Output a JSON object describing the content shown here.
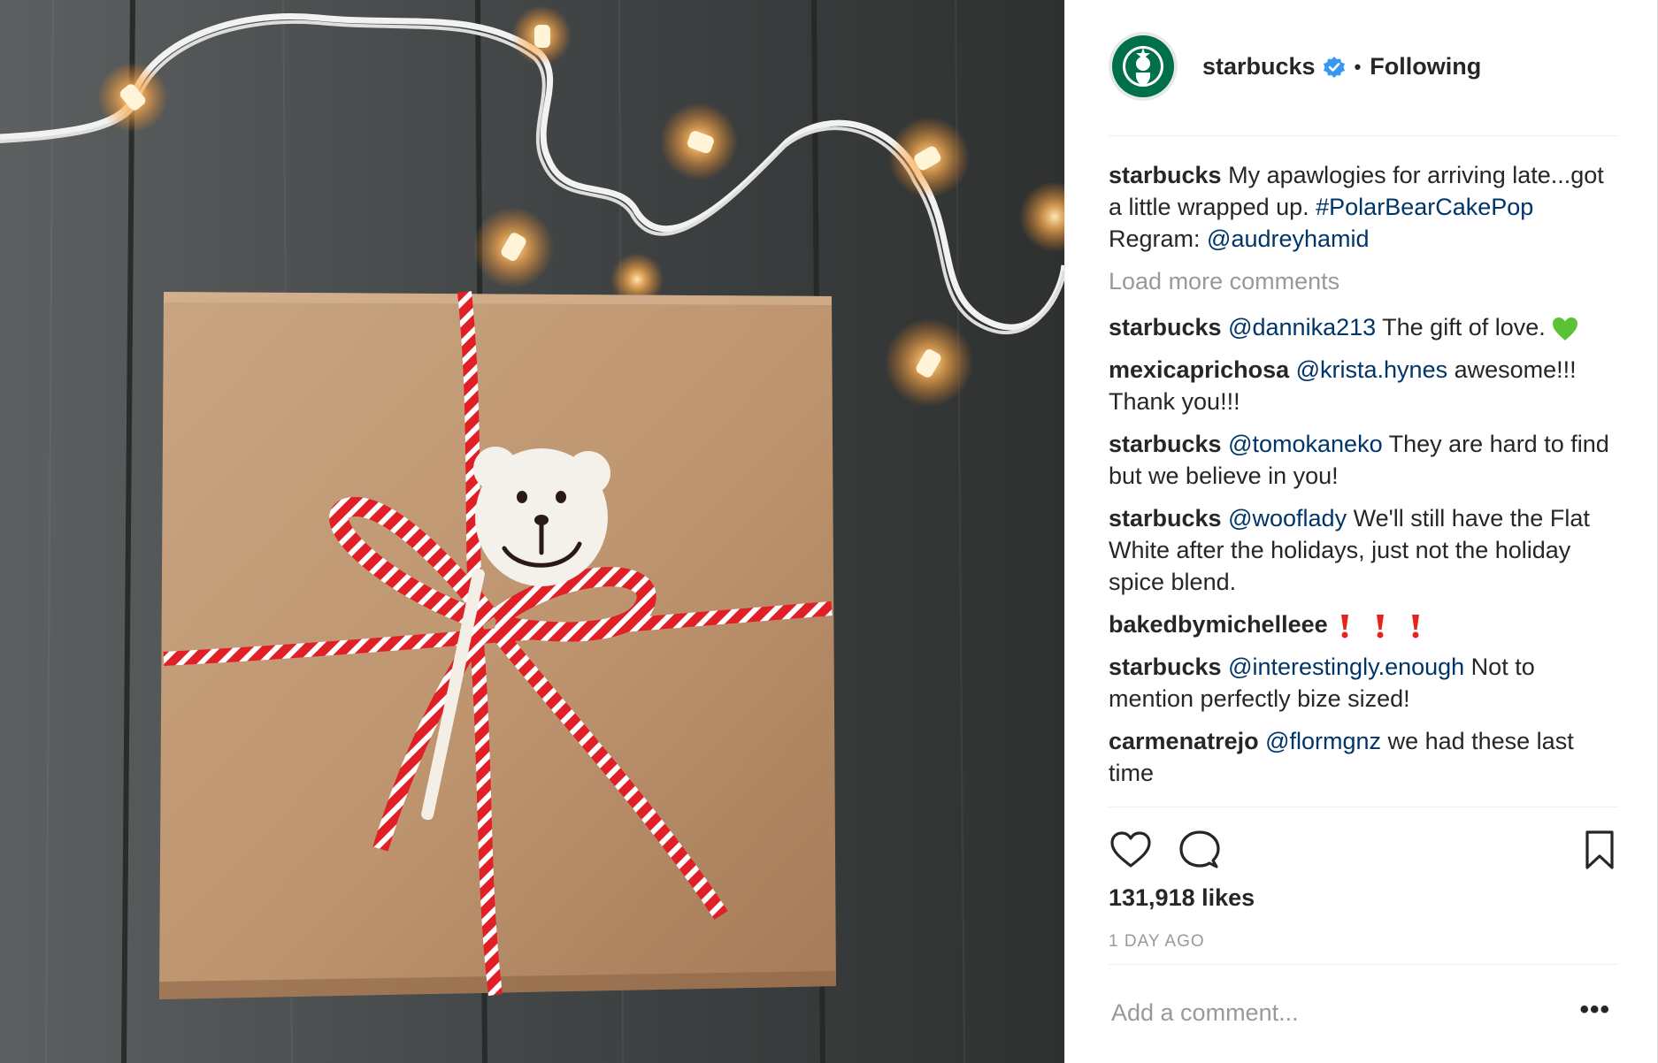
{
  "post": {
    "username": "starbucks",
    "follow_label": "Following",
    "dot": "•",
    "caption": {
      "user": "starbucks",
      "text": " My apawlogies for arriving late...got a little wrapped up. ",
      "hashtag": "#PolarBearCakePop",
      "regram_label": " Regram: ",
      "regram_user": "@audreyhamid"
    },
    "load_more": "Load more comments",
    "comments": [
      {
        "user": "starbucks",
        "mention": "@dannika213",
        "text": " The gift of love. ",
        "emoji": "green-heart"
      },
      {
        "user": "mexicaprichosa",
        "mention": "@krista.hynes",
        "text": " awesome!!! Thank you!!!"
      },
      {
        "user": "starbucks",
        "mention": "@tomokaneko",
        "text": " They are hard to find but we believe in you!"
      },
      {
        "user": "starbucks",
        "mention": "@wooflady",
        "text": " We'll still have the Flat White after the holidays, just not the holiday spice blend."
      },
      {
        "user": "bakedbymichelleee",
        "mention": "",
        "text": " ",
        "emoji": "red-exclamation-x3"
      },
      {
        "user": "starbucks",
        "mention": "@interestingly.enough",
        "text": " Not to mention perfectly bize sized!"
      },
      {
        "user": "carmenatrejo",
        "mention": "@flormgnz",
        "text": " we had these last time"
      }
    ],
    "likes": "131,918 likes",
    "timestamp": "1 DAY AGO",
    "comment_placeholder": "Add a comment...",
    "more_label": "•••",
    "colors": {
      "text": "#262626",
      "link": "#003569",
      "muted": "#999999",
      "verified": "#3897f0",
      "brand_green": "#00704a"
    }
  }
}
